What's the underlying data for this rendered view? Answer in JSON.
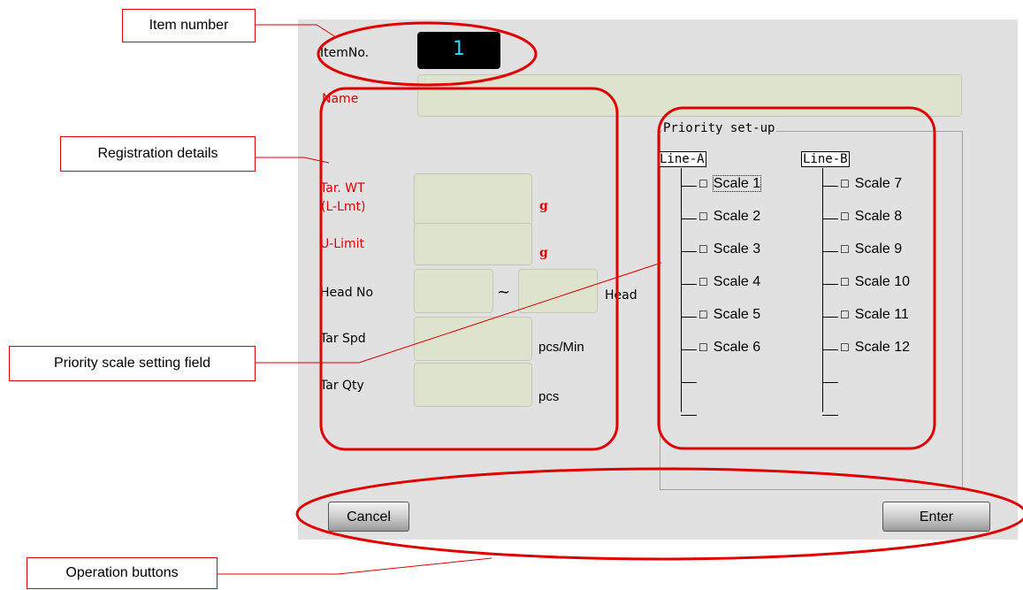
{
  "form": {
    "item_no_label": "ItemNo.",
    "item_no_value": "1",
    "name_label": "Name",
    "tar_wt_label_1": "Tar. WT",
    "tar_wt_label_2": "(L-Lmt)",
    "tar_wt_unit": "g",
    "u_limit_label": "U-Limit",
    "u_limit_unit": "g",
    "head_no_label": "Head No",
    "head_no_sep": "~",
    "head_no_unit": "Head",
    "tar_spd_label": "Tar Spd",
    "tar_spd_unit": "pcs/Min",
    "tar_qty_label": "Tar Qty",
    "tar_qty_unit": "pcs"
  },
  "priority": {
    "title": "Priority set-up",
    "line_a": "Line-A",
    "line_b": "Line-B",
    "line_a_scales": [
      "Scale 1",
      "Scale 2",
      "Scale 3",
      "Scale 4",
      "Scale 5",
      "Scale 6"
    ],
    "line_b_scales": [
      "Scale 7",
      "Scale 8",
      "Scale 9",
      "Scale 10",
      "Scale 11",
      "Scale 12"
    ],
    "checkbox_glyph": "☐"
  },
  "buttons": {
    "cancel": "Cancel",
    "enter": "Enter"
  },
  "callouts": {
    "item_number": "Item number",
    "registration_details": "Registration details",
    "priority_scale": "Priority scale setting field",
    "operation_buttons": "Operation buttons"
  },
  "colors": {
    "panel": "#e1e1e1",
    "field": "#dde3cc",
    "required_label": "#e00000",
    "annotation": "#e00000",
    "item_no_text": "#37d1ff"
  }
}
